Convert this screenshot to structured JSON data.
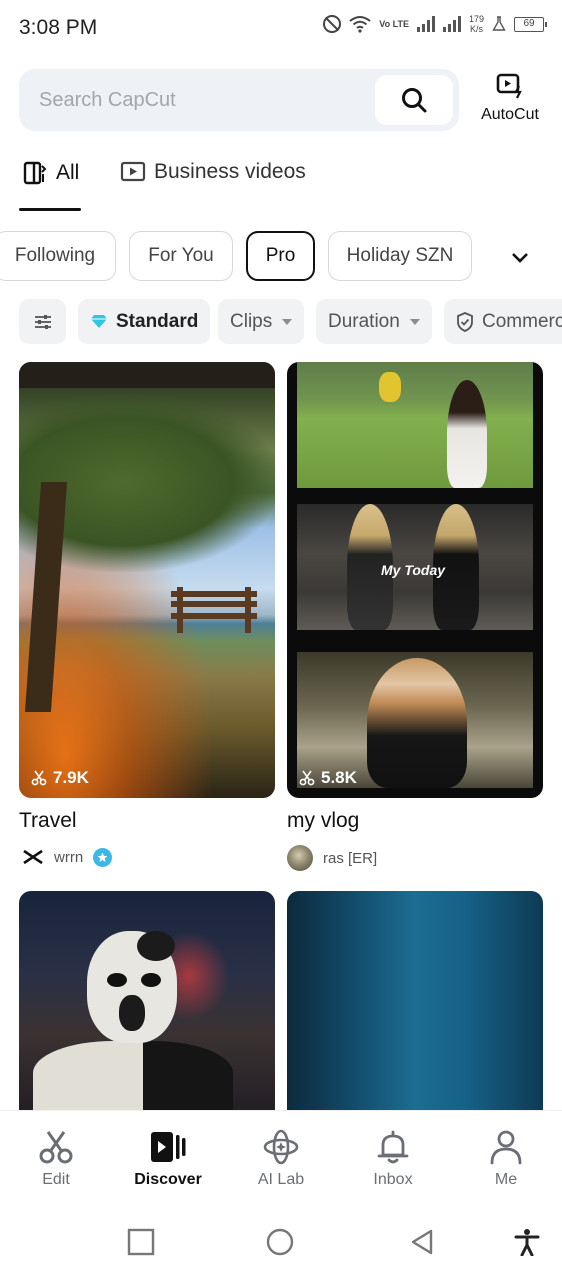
{
  "status_bar": {
    "time": "3:08 PM",
    "lte": "Vo LTE",
    "speed_top": "179",
    "speed_bottom": "K/s",
    "battery": "69"
  },
  "search": {
    "placeholder": "Search CapCut",
    "autocut_label": "AutoCut"
  },
  "tabs": [
    {
      "label": "All",
      "icon": "template-icon",
      "active": true
    },
    {
      "label": "Business videos",
      "icon": "play-icon",
      "active": false
    }
  ],
  "chips": [
    {
      "label": "Following",
      "active": false
    },
    {
      "label": "For You",
      "active": false
    },
    {
      "label": "Pro",
      "active": true
    },
    {
      "label": "Holiday SZN",
      "active": false
    }
  ],
  "filters": {
    "standard": "Standard",
    "clips": "Clips",
    "duration": "Duration",
    "commercial": "Commercial"
  },
  "cards": [
    {
      "title": "Travel",
      "uses": "7.9K",
      "author": "wrrn",
      "verified": true
    },
    {
      "title": "my vlog",
      "uses": "5.8K",
      "author": "ras [ER]",
      "verified": false,
      "overlay_text": "My Today"
    }
  ],
  "bottom_nav": [
    {
      "label": "Edit",
      "icon": "scissors-icon",
      "active": false
    },
    {
      "label": "Discover",
      "icon": "discover-icon",
      "active": true
    },
    {
      "label": "AI Lab",
      "icon": "atom-icon",
      "active": false
    },
    {
      "label": "Inbox",
      "icon": "bell-icon",
      "active": false
    },
    {
      "label": "Me",
      "icon": "person-icon",
      "active": false
    }
  ],
  "colors": {
    "accent": "#111111",
    "verified": "#3cb8e6",
    "diamond": "#2fc6e0",
    "muted": "#6b6f75"
  }
}
